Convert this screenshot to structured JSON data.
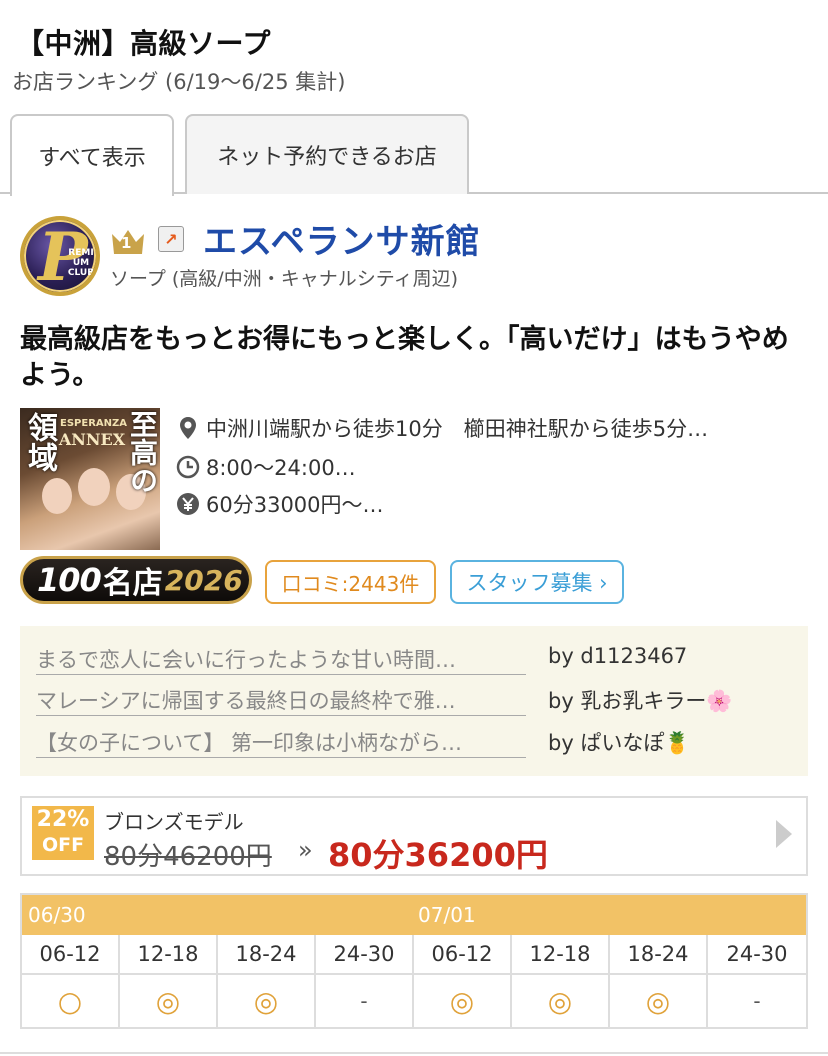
{
  "header": {
    "title": "【中洲】高級ソープ",
    "subtitle": "お店ランキング (6/19〜6/25 集計)"
  },
  "tabs": [
    {
      "label": "すべて表示",
      "active": true
    },
    {
      "label": "ネット予約できるお店",
      "active": false
    }
  ],
  "shop": {
    "rank": "1",
    "name": "エスペランサ新館",
    "category": "ソープ (高級/中洲・キャナルシティ周辺)",
    "catchcopy": "最高級店をもっとお得にもっと楽しく。「高いだけ」はもうやめよう。",
    "logo_text": "REMI UM CLUB",
    "photo_text_left": "領域",
    "photo_text_right": "至高の",
    "photo_brand": "ESPERANZA",
    "photo_annex": "ANNEX",
    "access": "中洲川端駅から徒歩10分　櫛田神社駅から徒歩5分…",
    "hours": "8:00〜24:00…",
    "price": "60分33000円〜…",
    "icons": {
      "access": "map-pin-icon",
      "hours": "clock-icon",
      "price": "yen-icon"
    },
    "colors": {
      "name": "#1f4ba8",
      "accent": "#e8a33c",
      "sale": "#c8281d"
    }
  },
  "badges": {
    "meiten_num": "100",
    "meiten_label": "名店",
    "meiten_year": "2026",
    "kuchikomi": "口コミ:2443件",
    "staff": "スタッフ募集 ›"
  },
  "reviews": [
    {
      "title": "まるで恋人に会いに行ったような甘い時間…",
      "by": "by d1123467"
    },
    {
      "title": "マレーシアに帰国する最終日の最終枠で雅…",
      "by": "by 乳お乳キラー🌸"
    },
    {
      "title": "【女の子について】 第一印象は小柄ながら…",
      "by": "by ぱいなぽ🍍"
    }
  ],
  "deal": {
    "discount": "22%",
    "off": "OFF",
    "model": "ブロンズモデル",
    "old_price": "80分46200円",
    "arrow": "»",
    "new_price": "80分36200円"
  },
  "schedule": {
    "dates": [
      "06/30",
      "07/01"
    ],
    "slots": [
      "06-12",
      "12-18",
      "18-24",
      "24-30",
      "06-12",
      "12-18",
      "18-24",
      "24-30"
    ],
    "marks": [
      "○",
      "◎",
      "◎",
      "-",
      "◎",
      "◎",
      "◎",
      "-"
    ]
  }
}
